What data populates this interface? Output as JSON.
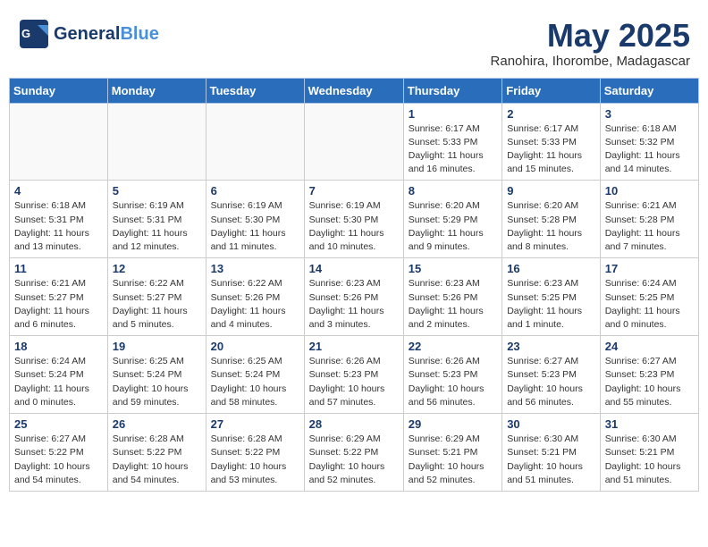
{
  "header": {
    "logo_general": "General",
    "logo_blue": "Blue",
    "month_year": "May 2025",
    "location": "Ranohira, Ihorombe, Madagascar"
  },
  "days_of_week": [
    "Sunday",
    "Monday",
    "Tuesday",
    "Wednesday",
    "Thursday",
    "Friday",
    "Saturday"
  ],
  "weeks": [
    [
      {
        "day": "",
        "info": ""
      },
      {
        "day": "",
        "info": ""
      },
      {
        "day": "",
        "info": ""
      },
      {
        "day": "",
        "info": ""
      },
      {
        "day": "1",
        "info": "Sunrise: 6:17 AM\nSunset: 5:33 PM\nDaylight: 11 hours and 16 minutes."
      },
      {
        "day": "2",
        "info": "Sunrise: 6:17 AM\nSunset: 5:33 PM\nDaylight: 11 hours and 15 minutes."
      },
      {
        "day": "3",
        "info": "Sunrise: 6:18 AM\nSunset: 5:32 PM\nDaylight: 11 hours and 14 minutes."
      }
    ],
    [
      {
        "day": "4",
        "info": "Sunrise: 6:18 AM\nSunset: 5:31 PM\nDaylight: 11 hours and 13 minutes."
      },
      {
        "day": "5",
        "info": "Sunrise: 6:19 AM\nSunset: 5:31 PM\nDaylight: 11 hours and 12 minutes."
      },
      {
        "day": "6",
        "info": "Sunrise: 6:19 AM\nSunset: 5:30 PM\nDaylight: 11 hours and 11 minutes."
      },
      {
        "day": "7",
        "info": "Sunrise: 6:19 AM\nSunset: 5:30 PM\nDaylight: 11 hours and 10 minutes."
      },
      {
        "day": "8",
        "info": "Sunrise: 6:20 AM\nSunset: 5:29 PM\nDaylight: 11 hours and 9 minutes."
      },
      {
        "day": "9",
        "info": "Sunrise: 6:20 AM\nSunset: 5:28 PM\nDaylight: 11 hours and 8 minutes."
      },
      {
        "day": "10",
        "info": "Sunrise: 6:21 AM\nSunset: 5:28 PM\nDaylight: 11 hours and 7 minutes."
      }
    ],
    [
      {
        "day": "11",
        "info": "Sunrise: 6:21 AM\nSunset: 5:27 PM\nDaylight: 11 hours and 6 minutes."
      },
      {
        "day": "12",
        "info": "Sunrise: 6:22 AM\nSunset: 5:27 PM\nDaylight: 11 hours and 5 minutes."
      },
      {
        "day": "13",
        "info": "Sunrise: 6:22 AM\nSunset: 5:26 PM\nDaylight: 11 hours and 4 minutes."
      },
      {
        "day": "14",
        "info": "Sunrise: 6:23 AM\nSunset: 5:26 PM\nDaylight: 11 hours and 3 minutes."
      },
      {
        "day": "15",
        "info": "Sunrise: 6:23 AM\nSunset: 5:26 PM\nDaylight: 11 hours and 2 minutes."
      },
      {
        "day": "16",
        "info": "Sunrise: 6:23 AM\nSunset: 5:25 PM\nDaylight: 11 hours and 1 minute."
      },
      {
        "day": "17",
        "info": "Sunrise: 6:24 AM\nSunset: 5:25 PM\nDaylight: 11 hours and 0 minutes."
      }
    ],
    [
      {
        "day": "18",
        "info": "Sunrise: 6:24 AM\nSunset: 5:24 PM\nDaylight: 11 hours and 0 minutes."
      },
      {
        "day": "19",
        "info": "Sunrise: 6:25 AM\nSunset: 5:24 PM\nDaylight: 10 hours and 59 minutes."
      },
      {
        "day": "20",
        "info": "Sunrise: 6:25 AM\nSunset: 5:24 PM\nDaylight: 10 hours and 58 minutes."
      },
      {
        "day": "21",
        "info": "Sunrise: 6:26 AM\nSunset: 5:23 PM\nDaylight: 10 hours and 57 minutes."
      },
      {
        "day": "22",
        "info": "Sunrise: 6:26 AM\nSunset: 5:23 PM\nDaylight: 10 hours and 56 minutes."
      },
      {
        "day": "23",
        "info": "Sunrise: 6:27 AM\nSunset: 5:23 PM\nDaylight: 10 hours and 56 minutes."
      },
      {
        "day": "24",
        "info": "Sunrise: 6:27 AM\nSunset: 5:23 PM\nDaylight: 10 hours and 55 minutes."
      }
    ],
    [
      {
        "day": "25",
        "info": "Sunrise: 6:27 AM\nSunset: 5:22 PM\nDaylight: 10 hours and 54 minutes."
      },
      {
        "day": "26",
        "info": "Sunrise: 6:28 AM\nSunset: 5:22 PM\nDaylight: 10 hours and 54 minutes."
      },
      {
        "day": "27",
        "info": "Sunrise: 6:28 AM\nSunset: 5:22 PM\nDaylight: 10 hours and 53 minutes."
      },
      {
        "day": "28",
        "info": "Sunrise: 6:29 AM\nSunset: 5:22 PM\nDaylight: 10 hours and 52 minutes."
      },
      {
        "day": "29",
        "info": "Sunrise: 6:29 AM\nSunset: 5:21 PM\nDaylight: 10 hours and 52 minutes."
      },
      {
        "day": "30",
        "info": "Sunrise: 6:30 AM\nSunset: 5:21 PM\nDaylight: 10 hours and 51 minutes."
      },
      {
        "day": "31",
        "info": "Sunrise: 6:30 AM\nSunset: 5:21 PM\nDaylight: 10 hours and 51 minutes."
      }
    ]
  ]
}
